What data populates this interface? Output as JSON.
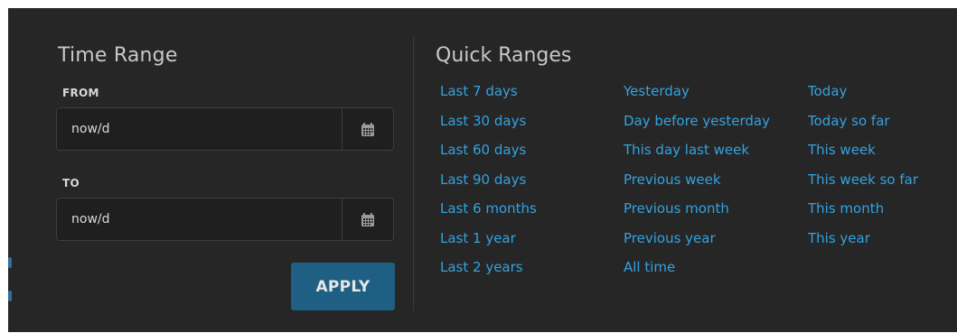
{
  "time_range": {
    "title": "Time Range",
    "from_label": "FROM",
    "from_value": "now/d",
    "to_label": "TO",
    "to_value": "now/d",
    "calendar_icon": "calendar-icon",
    "apply_label": "APPLY"
  },
  "quick_ranges": {
    "title": "Quick Ranges",
    "columns": [
      [
        "Last 7 days",
        "Last 30 days",
        "Last 60 days",
        "Last 90 days",
        "Last 6 months",
        "Last 1 year",
        "Last 2 years"
      ],
      [
        "Yesterday",
        "Day before yesterday",
        "This day last week",
        "Previous week",
        "Previous month",
        "Previous year",
        "All time"
      ],
      [
        "Today",
        "Today so far",
        "This week",
        "This week so far",
        "This month",
        "This year"
      ]
    ]
  },
  "colors": {
    "panel_bg": "#262626",
    "link": "#33a2e0",
    "apply_bg": "#1f5f83"
  }
}
